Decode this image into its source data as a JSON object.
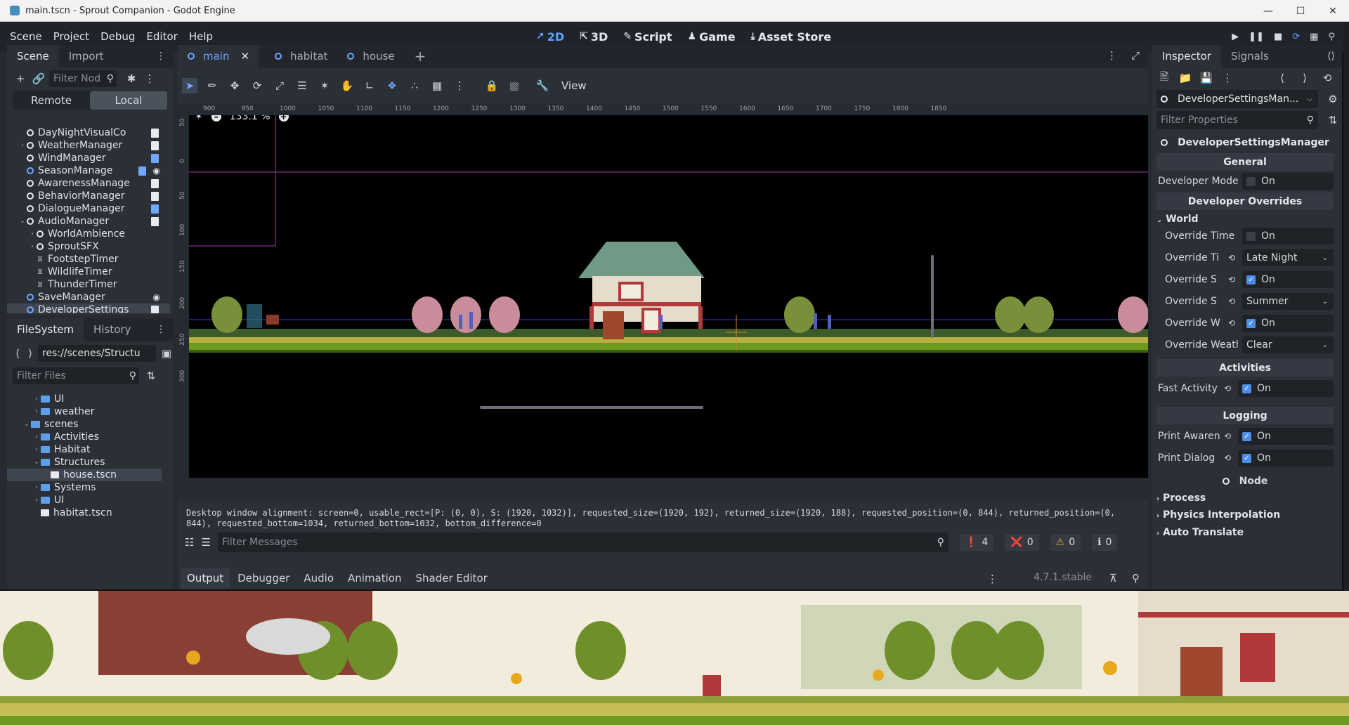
{
  "window": {
    "title": "main.tscn - Sprout Companion - Godot Engine"
  },
  "menu": [
    "Scene",
    "Project",
    "Debug",
    "Editor",
    "Help"
  ],
  "workspaces": [
    {
      "label": "2D",
      "icon": "2d-icon"
    },
    {
      "label": "3D",
      "icon": "3d-icon"
    },
    {
      "label": "Script",
      "icon": "script-icon"
    },
    {
      "label": "Game",
      "icon": "game-icon"
    },
    {
      "label": "Asset Store",
      "icon": "asset-store-icon"
    }
  ],
  "scene_dock": {
    "tabs": [
      "Scene",
      "Import"
    ],
    "filter_placeholder": "Filter Nod",
    "remote_label": "Remote",
    "local_label": "Local",
    "nodes": [
      {
        "label": "DayNightVisualCo",
        "depth": 1,
        "icon": "node",
        "arrow": "",
        "script": "white"
      },
      {
        "label": "WeatherManager",
        "depth": 1,
        "icon": "node",
        "arrow": "›",
        "script": "white"
      },
      {
        "label": "WindManager",
        "depth": 1,
        "icon": "node",
        "arrow": "",
        "script": "blue"
      },
      {
        "label": "SeasonManage",
        "depth": 1,
        "icon": "node-blue",
        "arrow": "",
        "script": "blue",
        "eye": true
      },
      {
        "label": "AwarenessManage",
        "depth": 1,
        "icon": "node",
        "arrow": "",
        "script": "white"
      },
      {
        "label": "BehaviorManager",
        "depth": 1,
        "icon": "node",
        "arrow": "",
        "script": "white"
      },
      {
        "label": "DialogueManager",
        "depth": 1,
        "icon": "node",
        "arrow": "",
        "script": "blue"
      },
      {
        "label": "AudioManager",
        "depth": 1,
        "icon": "node",
        "arrow": "⌄",
        "script": "white"
      },
      {
        "label": "WorldAmbience",
        "depth": 2,
        "icon": "node",
        "arrow": "›",
        "script": ""
      },
      {
        "label": "SproutSFX",
        "depth": 2,
        "icon": "node",
        "arrow": "›",
        "script": ""
      },
      {
        "label": "FootstepTimer",
        "depth": 2,
        "icon": "timer",
        "arrow": "",
        "script": ""
      },
      {
        "label": "WildlifeTimer",
        "depth": 2,
        "icon": "timer",
        "arrow": "",
        "script": ""
      },
      {
        "label": "ThunderTimer",
        "depth": 2,
        "icon": "timer",
        "arrow": "",
        "script": ""
      },
      {
        "label": "SaveManager",
        "depth": 1,
        "icon": "node-blue",
        "arrow": "",
        "script": "",
        "eye": true
      },
      {
        "label": "DeveloperSettings",
        "depth": 1,
        "icon": "node-blue",
        "arrow": "",
        "script": "white",
        "selected": true
      }
    ]
  },
  "filesystem_dock": {
    "tabs": [
      "FileSystem",
      "History"
    ],
    "path": "res://scenes/Structu",
    "filter_placeholder": "Filter Files",
    "items": [
      {
        "label": "UI",
        "depth": 1,
        "type": "folder",
        "arrow": "›"
      },
      {
        "label": "weather",
        "depth": 1,
        "type": "folder",
        "arrow": "›"
      },
      {
        "label": "scenes",
        "depth": 0,
        "type": "folder",
        "arrow": "⌄"
      },
      {
        "label": "Activities",
        "depth": 1,
        "type": "folder",
        "arrow": "›"
      },
      {
        "label": "Habitat",
        "depth": 1,
        "type": "folder",
        "arrow": "›"
      },
      {
        "label": "Structures",
        "depth": 1,
        "type": "folder",
        "arrow": "⌄"
      },
      {
        "label": "house.tscn",
        "depth": 2,
        "type": "file",
        "arrow": "",
        "selected": true
      },
      {
        "label": "Systems",
        "depth": 1,
        "type": "folder",
        "arrow": "›"
      },
      {
        "label": "UI",
        "depth": 1,
        "type": "folder",
        "arrow": "›"
      },
      {
        "label": "habitat.tscn",
        "depth": 1,
        "type": "file",
        "arrow": ""
      }
    ]
  },
  "editor_tabs": [
    {
      "label": "main",
      "active": true
    },
    {
      "label": "habitat",
      "active": false
    },
    {
      "label": "house",
      "active": false
    }
  ],
  "toolbar": {
    "view_label": "View"
  },
  "viewport": {
    "zoom": "133.1 %",
    "ruler_h": [
      "900",
      "950",
      "1000",
      "1050",
      "1100",
      "1150",
      "1200",
      "1250",
      "1300",
      "1350",
      "1400",
      "1450",
      "1500",
      "1550",
      "1600",
      "1650",
      "1700",
      "1750",
      "1800",
      "1850"
    ],
    "ruler_v": [
      "50",
      "0",
      "50",
      "100",
      "150",
      "200",
      "250",
      "300"
    ]
  },
  "output": {
    "log": "Desktop window alignment: screen=0, usable_rect=[P: (0, 0), S: (1920, 1032)], requested_size=(1920, 192), returned_size=(1920, 188), requested_position=(0, 844), returned_position=(0, 844), requested_bottom=1034, returned_bottom=1032, bottom_difference=0",
    "filter_placeholder": "Filter Messages",
    "counts": {
      "messages": "4",
      "errors": "0",
      "warnings": "0",
      "info": "0"
    },
    "tabs": [
      "Output",
      "Debugger",
      "Audio",
      "Animation",
      "Shader Editor"
    ],
    "version": "4.7.1.stable"
  },
  "inspector": {
    "tabs": [
      "Inspector",
      "Signals"
    ],
    "object_name": "DeveloperSettingsMan...",
    "filter_placeholder": "Filter Properties",
    "class_header": "DeveloperSettingsManager",
    "sections": {
      "general": "General",
      "overrides": "Developer Overrides",
      "world_group": "World",
      "activities": "Activities",
      "logging": "Logging",
      "node": "Node"
    },
    "props": {
      "developer_mode": {
        "label": "Developer Mode",
        "value": "On",
        "checked": false
      },
      "override_time": {
        "label": "Override Time",
        "value": "On",
        "checked": false
      },
      "override_ti": {
        "label": "Override Ti",
        "value": "Late Night"
      },
      "override_s1": {
        "label": "Override S",
        "value": "On",
        "checked": true
      },
      "override_s2": {
        "label": "Override S",
        "value": "Summer"
      },
      "override_w": {
        "label": "Override W",
        "value": "On",
        "checked": true
      },
      "override_weath": {
        "label": "Override Weath",
        "value": "Clear"
      },
      "fast_activity": {
        "label": "Fast Activity",
        "value": "On",
        "checked": true
      },
      "print_awaren": {
        "label": "Print Awaren",
        "value": "On",
        "checked": true
      },
      "print_dialog": {
        "label": "Print Dialog",
        "value": "On",
        "checked": true
      }
    },
    "collapsed_groups": [
      "Process",
      "Physics Interpolation",
      "Auto Translate"
    ]
  }
}
